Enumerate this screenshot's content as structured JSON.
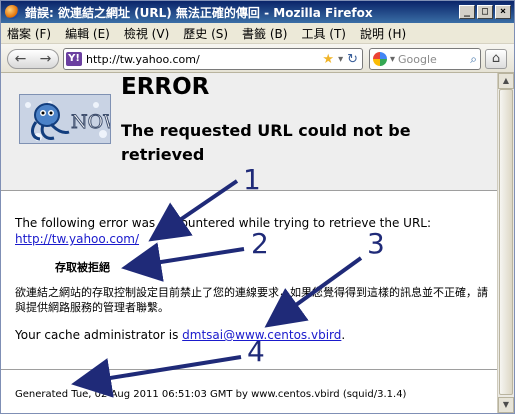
{
  "window": {
    "title": "錯誤: 欲連結之網址 (URL) 無法正確的傳回 - Mozilla Firefox",
    "controls": {
      "minimize": "_",
      "maximize": "□",
      "close": "×"
    }
  },
  "menu": [
    "檔案 (F)",
    "編輯 (E)",
    "檢視 (V)",
    "歷史 (S)",
    "書籤 (B)",
    "工具 (T)",
    "說明 (H)"
  ],
  "toolbar": {
    "back_icon": "←",
    "forward_icon": "→",
    "site_badge": "Y!",
    "url": "http://tw.yahoo.com/",
    "star_icon": "★",
    "dropdown_icon": "▾",
    "reload_icon": "↻",
    "search_engine_name": "Google",
    "search_icon": "⌕",
    "home_icon": "⌂"
  },
  "page": {
    "title": "ERROR",
    "subtitle": "The requested URL could not be retrieved",
    "intro": "The following error was encountered while trying to retrieve the URL:",
    "url_link": "http://tw.yahoo.com/",
    "denied": "存取被拒絕",
    "chinese_message": "欲連結之網站的存取控制設定目前禁止了您的連線要求，如果您覺得得到這樣的訊息並不正確，請與提供網路服務的管理者聯繫。",
    "cache_prefix": "Your cache administrator is",
    "cache_email": "dmtsai@www.centos.vbird",
    "cache_suffix": ".",
    "footer": "Generated Tue, 02 Aug 2011 06:51:03 GMT by www.centos.vbird (squid/3.1.4)"
  },
  "annotations": {
    "labels": [
      "1",
      "2",
      "3",
      "4"
    ],
    "color": "#1f2a78"
  },
  "colors": {
    "title_bar_start": "#0a246a",
    "title_bar_end": "#3a6ea5",
    "link": "#1a1acc",
    "header_band": "#eeeeee"
  }
}
